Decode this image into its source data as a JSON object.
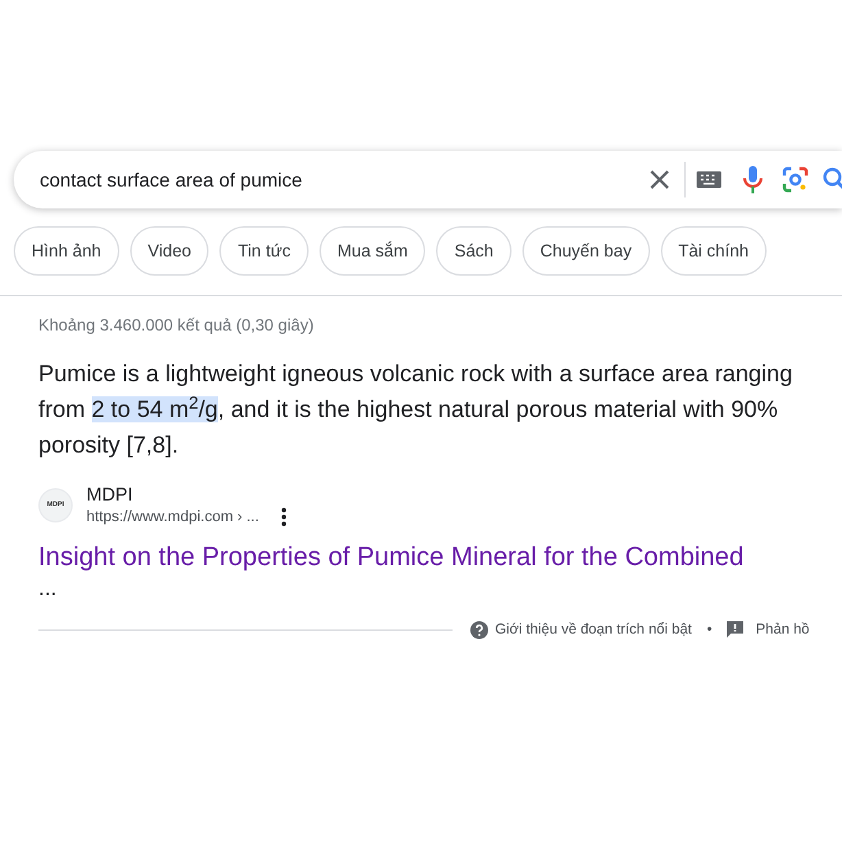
{
  "search": {
    "value": "contact surface area of pumice"
  },
  "filters": [
    {
      "label": "Hình ảnh"
    },
    {
      "label": "Video"
    },
    {
      "label": "Tin tức"
    },
    {
      "label": "Mua sắm"
    },
    {
      "label": "Sách"
    },
    {
      "label": "Chuyến bay"
    },
    {
      "label": "Tài chính"
    }
  ],
  "result_stats": "Khoảng 3.460.000 kết quả (0,30 giây)",
  "snippet": {
    "before": "Pumice is a lightweight igneous volcanic rock with a surface area ranging from ",
    "highlight": "2 to 54 m$^{2}$/g",
    "after": ", and it is the highest natural porous material with 90% porosity [7,8]."
  },
  "source": {
    "favicon_text": "MDPI",
    "site": "MDPI",
    "url": "https://www.mdpi.com › ...",
    "title": "Insight on the Properties of Pumice Mineral for the Combined",
    "title_rest": "..."
  },
  "footer": {
    "about": "Giới thiệu về đoạn trích nổi bật",
    "separator": "•",
    "feedback": "Phản hồ"
  }
}
